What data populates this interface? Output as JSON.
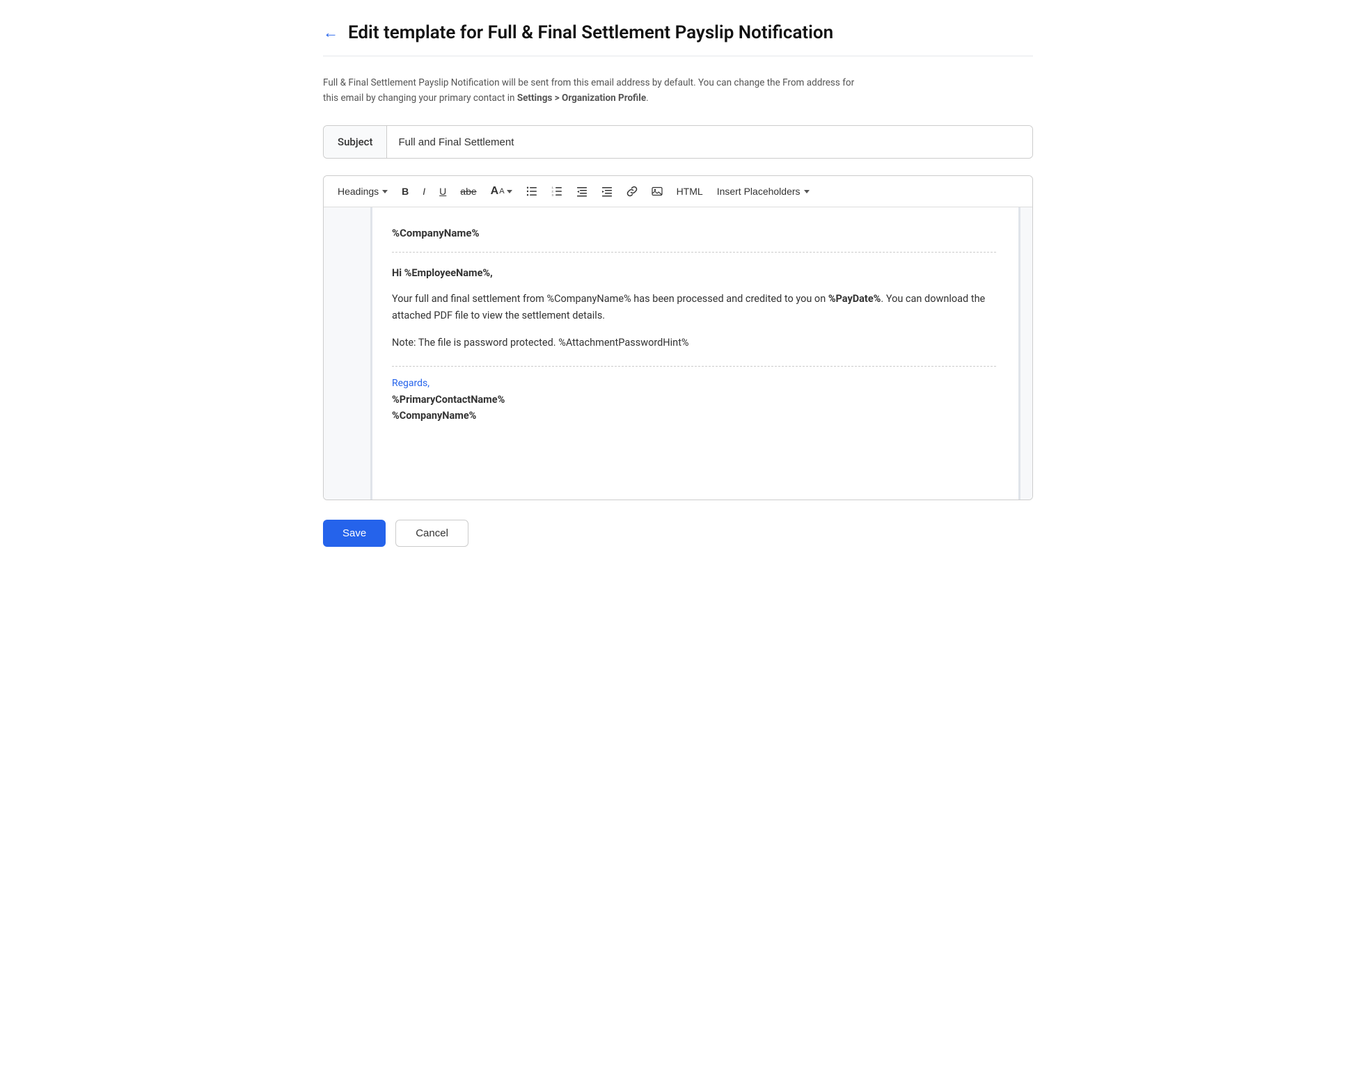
{
  "page": {
    "title": "Edit template for Full & Final Settlement Payslip Notification",
    "back_label": "←"
  },
  "info": {
    "text1": "Full & Final Settlement Payslip Notification will be sent from this email address by default. You can change the From address for",
    "text2": "this email by changing your primary contact in ",
    "link_text": "Settings > Organization Profile",
    "text3": "."
  },
  "subject": {
    "label": "Subject",
    "value": "Full and Final Settlement"
  },
  "toolbar": {
    "headings_label": "Headings",
    "bold_label": "B",
    "italic_label": "I",
    "underline_label": "U",
    "strikethrough_label": "abe",
    "font_size_label": "A",
    "html_label": "HTML",
    "insert_placeholders_label": "Insert Placeholders"
  },
  "editor": {
    "company_name": "%CompanyName%",
    "greeting": "Hi %EmployeeName%,",
    "para1_prefix": "Your full and final settlement from %CompanyName% has been processed and credited to you on ",
    "para1_bold": "%PayDate%",
    "para1_suffix": ". You can download the attached PDF file to view the settlement details.",
    "note": "Note: The file is password protected. %AttachmentPasswordHint%",
    "regards": "Regards,",
    "primary_contact": "%PrimaryContactName%",
    "company_name_footer": "%CompanyName%"
  },
  "footer": {
    "save_label": "Save",
    "cancel_label": "Cancel"
  }
}
